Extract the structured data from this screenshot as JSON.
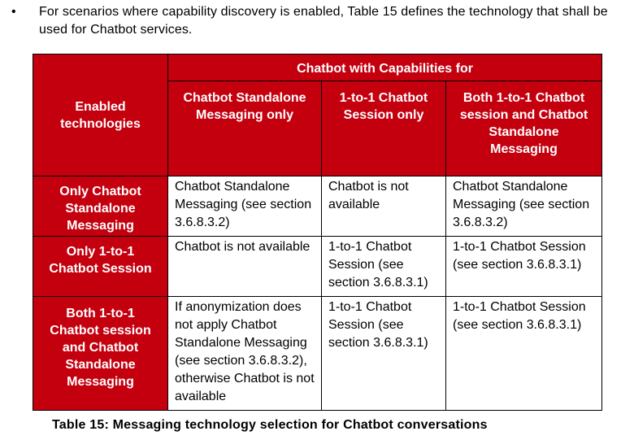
{
  "intro": {
    "bullet": "•",
    "text": "For scenarios where capability discovery is enabled, Table 15 defines the technology that shall be used for Chatbot services."
  },
  "table": {
    "corner_header": "Enabled technologies",
    "group_header": "Chatbot with Capabilities for",
    "columns": [
      "Chatbot Standalone Messaging only",
      "1-to-1 Chatbot Session only",
      "Both 1-to-1 Chatbot session and Chatbot Standalone Messaging"
    ],
    "rows": [
      {
        "label": "Only Chatbot Standalone Messaging",
        "cells": [
          "Chatbot Standalone Messaging (see section 3.6.8.3.2)",
          "Chatbot is not available",
          "Chatbot Standalone Messaging (see section 3.6.8.3.2)"
        ]
      },
      {
        "label": "Only 1-to-1 Chatbot Session",
        "cells": [
          "Chatbot is not available",
          "1-to-1 Chatbot Session (see section 3.6.8.3.1)",
          "1-to-1 Chatbot Session (see section 3.6.8.3.1)"
        ]
      },
      {
        "label": "Both 1-to-1 Chatbot session and Chatbot Standalone Messaging",
        "cells": [
          "If anonymization does not apply Chatbot Standalone Messaging (see section 3.6.8.3.2), otherwise Chatbot is not available",
          "1-to-1 Chatbot Session (see section 3.6.8.3.1)",
          "1-to-1 Chatbot Session (see section 3.6.8.3.1)"
        ]
      }
    ],
    "header_color": "#c4000f"
  },
  "caption": "Table 15: Messaging technology selection for Chatbot conversations"
}
